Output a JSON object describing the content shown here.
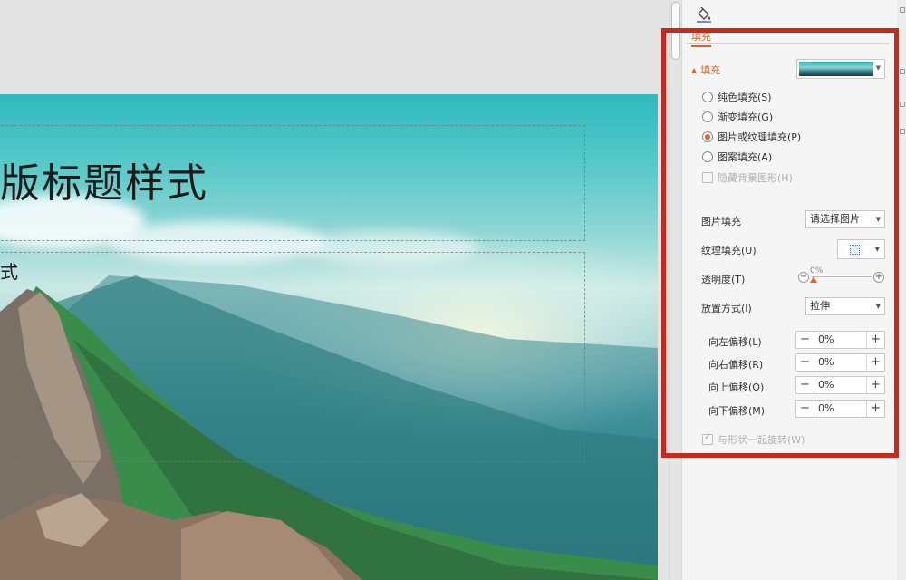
{
  "slide": {
    "title": "版标题样式",
    "subtitle": "式"
  },
  "pane": {
    "icon": "fill-bucket-icon",
    "tab": "填充",
    "section": {
      "label": "填充",
      "collapse_icon": "caret-up-icon"
    },
    "fill_types": [
      {
        "label": "纯色填充(S)",
        "checked": false
      },
      {
        "label": "渐变填充(G)",
        "checked": false
      },
      {
        "label": "图片或纹理填充(P)",
        "checked": true
      },
      {
        "label": "图案填充(A)",
        "checked": false
      }
    ],
    "hide_bg": {
      "label": "隐藏背景图形(H)",
      "checked": false,
      "enabled": false
    },
    "picture_fill": {
      "label": "图片填充",
      "value": "请选择图片"
    },
    "texture_fill": {
      "label": "纹理填充(U)"
    },
    "transparency": {
      "label": "透明度(T)",
      "value": "0%",
      "level": 0
    },
    "placement": {
      "label": "放置方式(I)",
      "value": "拉伸"
    },
    "offsets": [
      {
        "label": "向左偏移(L)",
        "value": "0%"
      },
      {
        "label": "向右偏移(R)",
        "value": "0%"
      },
      {
        "label": "向上偏移(O)",
        "value": "0%"
      },
      {
        "label": "向下偏移(M)",
        "value": "0%"
      }
    ],
    "rotate_with_shape": {
      "label": "与形状一起旋转(W)",
      "checked": true,
      "enabled": false
    }
  },
  "colors": {
    "accent": "#e0622a",
    "highlight_box": "#c9291b"
  }
}
